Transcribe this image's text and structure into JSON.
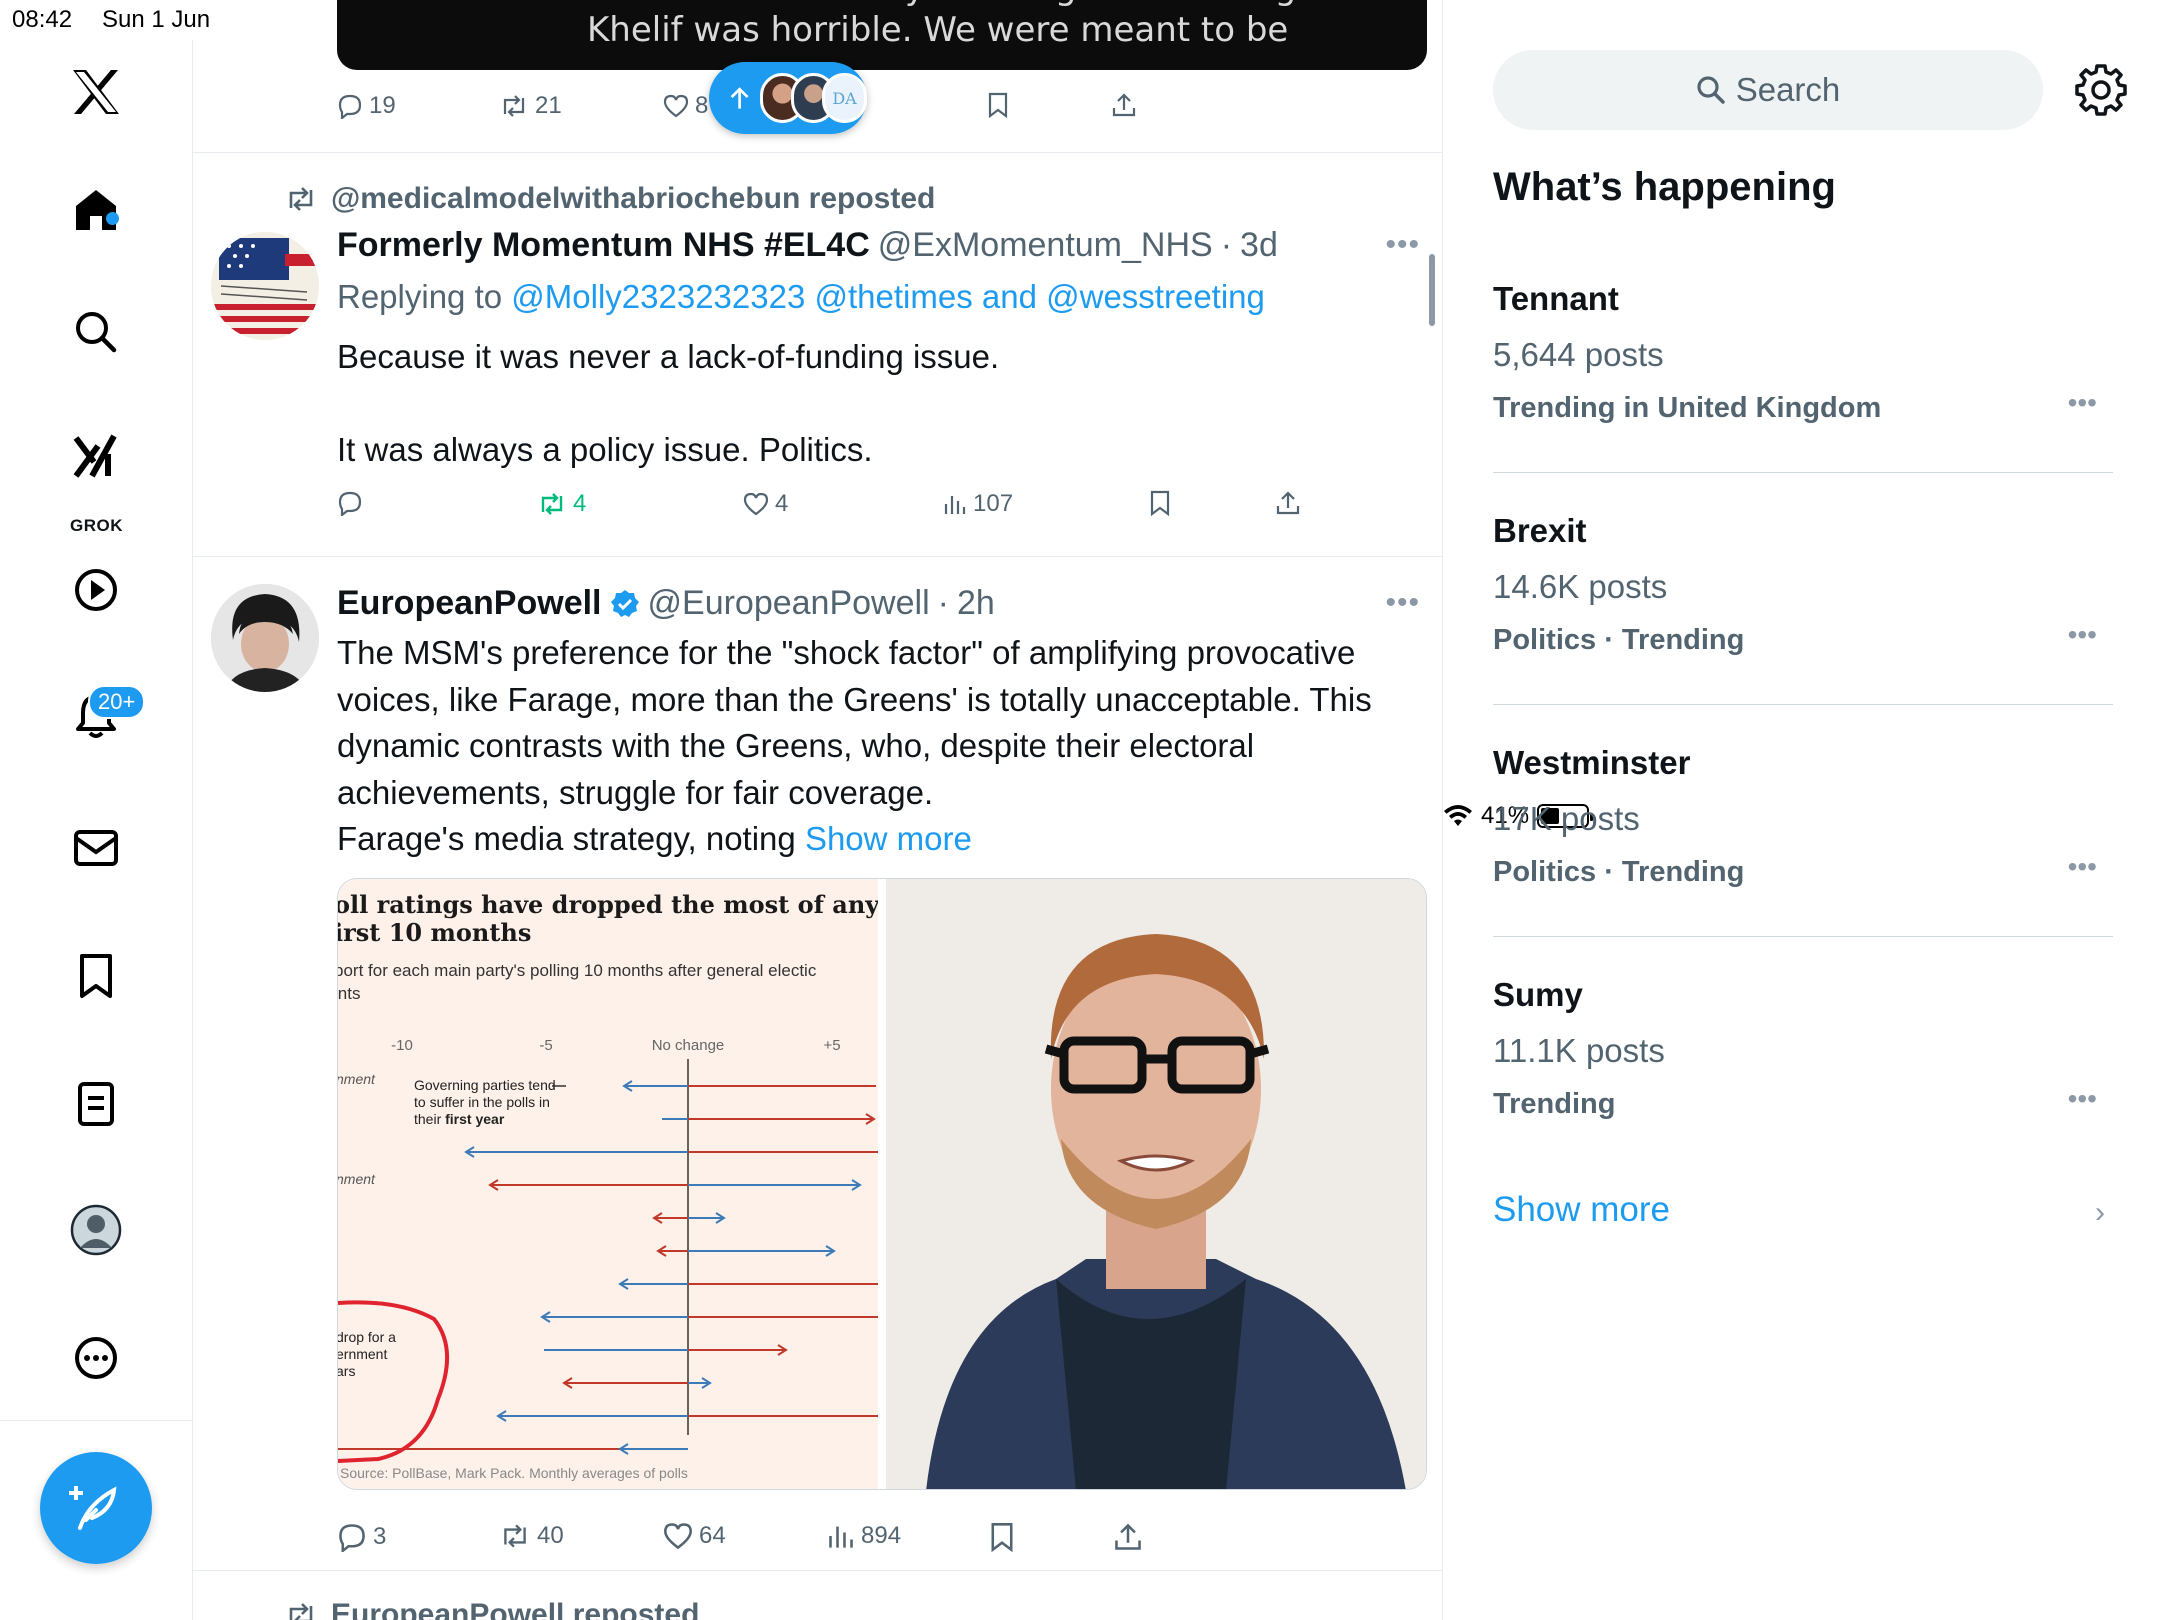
{
  "status_bar": {
    "time": "08:42",
    "date": "Sun 1 Jun",
    "battery": "41%"
  },
  "nav": {
    "grok_label": "GROK",
    "notifications_badge": "20+"
  },
  "top_post": {
    "caption_line1": "The flak I and many others got for writing about",
    "caption_line2": "Khelif was horrible.  We were  meant to be",
    "replies": "19",
    "reposts": "21",
    "likes": "8"
  },
  "post1": {
    "repost_label": "@medicalmodelwithabriochebun reposted",
    "name": "Formerly Momentum NHS #EL4C",
    "handle": "@ExMomentum_NHS",
    "time": "3d",
    "replying_prefix": "Replying to",
    "replying_to_1": "@Molly2323232323",
    "replying_to_2": "@thetimes",
    "replying_and": "and",
    "replying_to_3": "@wesstreeting",
    "text_1": "Because it was never a lack-of-funding issue.",
    "text_2": "It was always a policy issue. Politics.",
    "replies": "",
    "reposts": "4",
    "likes": "4",
    "views": "107"
  },
  "post2": {
    "name": "EuropeanPowell",
    "handle": "@EuropeanPowell",
    "time": "2h",
    "text": "The MSM's preference for the \"shock factor\" of amplifying provocative voices, like Farage, more than the Greens' is totally unacceptable. This dynamic contrasts with the Greens, who, despite their electoral achievements, struggle for fair coverage.",
    "text_2": "Farage's media strategy, noting",
    "show_more": "Show more",
    "replies": "3",
    "reposts": "40",
    "likes": "64",
    "views": "894",
    "chart": {
      "title_1": "oll ratings have dropped the most of any governi",
      "title_2": "irst 10 months",
      "subtitle_1": "port for each main party's polling 10 months after general electic",
      "subtitle_2": "ints",
      "ticks": [
        "-10",
        "-5",
        "No change",
        "+5"
      ],
      "row_label_1": "nment",
      "row_label_2": "nment",
      "annotation_1": "Governing parties tend",
      "annotation_2": "to suffer in the polls in",
      "annotation_3": "their",
      "annotation_3_bold": "first year",
      "annotation_4": "drop for a",
      "annotation_5": "ernment",
      "annotation_6": "ars",
      "source": "Source: PollBase, Mark Pack. Monthly averages of polls"
    }
  },
  "next_post": {
    "repost_label": "EuropeanPowell reposted"
  },
  "sidebar": {
    "search_placeholder": "Search",
    "heading": "What’s happening",
    "trends": [
      {
        "name": "Tennant",
        "posts": "5,644 posts",
        "context": "Trending in United Kingdom"
      },
      {
        "name": "Brexit",
        "posts": "14.6K posts",
        "context": "Politics · Trending"
      },
      {
        "name": "Westminster",
        "posts": "17K posts",
        "context": "Politics · Trending"
      },
      {
        "name": "Sumy",
        "posts": "11.1K posts",
        "context": "Trending"
      }
    ],
    "show_more": "Show more"
  },
  "colors": {
    "accent": "#1d9bf0",
    "repost_green": "#00ba7c",
    "muted": "#536471",
    "chart_red": "#c0392b",
    "chart_blue": "#3d7ab8"
  }
}
